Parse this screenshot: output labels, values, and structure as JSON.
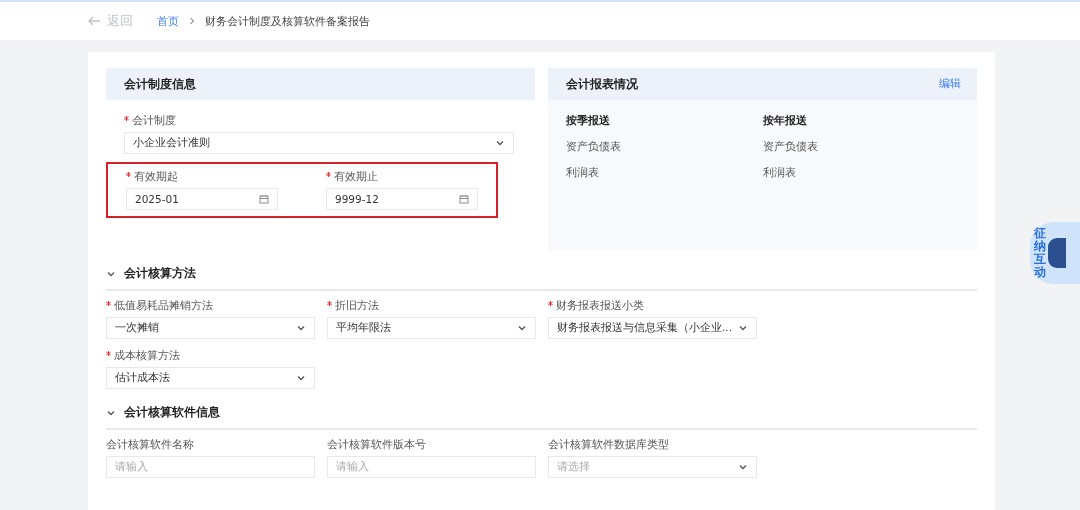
{
  "top_bar": {
    "back": "返回",
    "breadcrumb": [
      {
        "label": "首页",
        "link": true
      },
      {
        "label": "财务会计制度及核算软件备案报告",
        "link": false
      }
    ]
  },
  "system_panel": {
    "title": "会计制度信息",
    "fields": [
      {
        "label": "会计制度",
        "required": true,
        "kind": "select",
        "value": "小企业会计准则"
      }
    ],
    "date_range": {
      "highlighted": true,
      "fields": [
        {
          "label": "有效期起",
          "required": true,
          "kind": "date",
          "value": "2025-01"
        },
        {
          "label": "有效期止",
          "required": true,
          "kind": "date",
          "value": "9999-12"
        }
      ]
    }
  },
  "report_panel": {
    "title": "会计报表情况",
    "action": "编辑",
    "columns": [
      {
        "heading": "按季报送",
        "items": [
          "资产负债表",
          "利润表"
        ]
      },
      {
        "heading": "按年报送",
        "items": [
          "资产负债表",
          "利润表"
        ]
      }
    ]
  },
  "sections": [
    {
      "title": "会计核算方法",
      "expanded": true,
      "fields": [
        {
          "label": "低值易耗品摊销方法",
          "required": true,
          "kind": "select",
          "value": "一次摊销"
        },
        {
          "label": "折旧方法",
          "required": true,
          "kind": "select",
          "value": "平均年限法"
        },
        {
          "label": "财务报表报送小类",
          "required": true,
          "kind": "select",
          "value": "财务报表报送与信息采集（小企业..."
        },
        {
          "label": "成本核算方法",
          "required": true,
          "kind": "select",
          "value": "估计成本法"
        }
      ]
    },
    {
      "title": "会计核算软件信息",
      "expanded": true,
      "fields": [
        {
          "label": "会计核算软件名称",
          "required": false,
          "kind": "input",
          "placeholder": "请输入"
        },
        {
          "label": "会计核算软件版本号",
          "required": false,
          "kind": "input",
          "placeholder": "请输入"
        },
        {
          "label": "会计核算软件数据库类型",
          "required": false,
          "kind": "select",
          "placeholder": "请选择"
        }
      ]
    }
  ],
  "assistant": {
    "label": "征纳互动"
  }
}
